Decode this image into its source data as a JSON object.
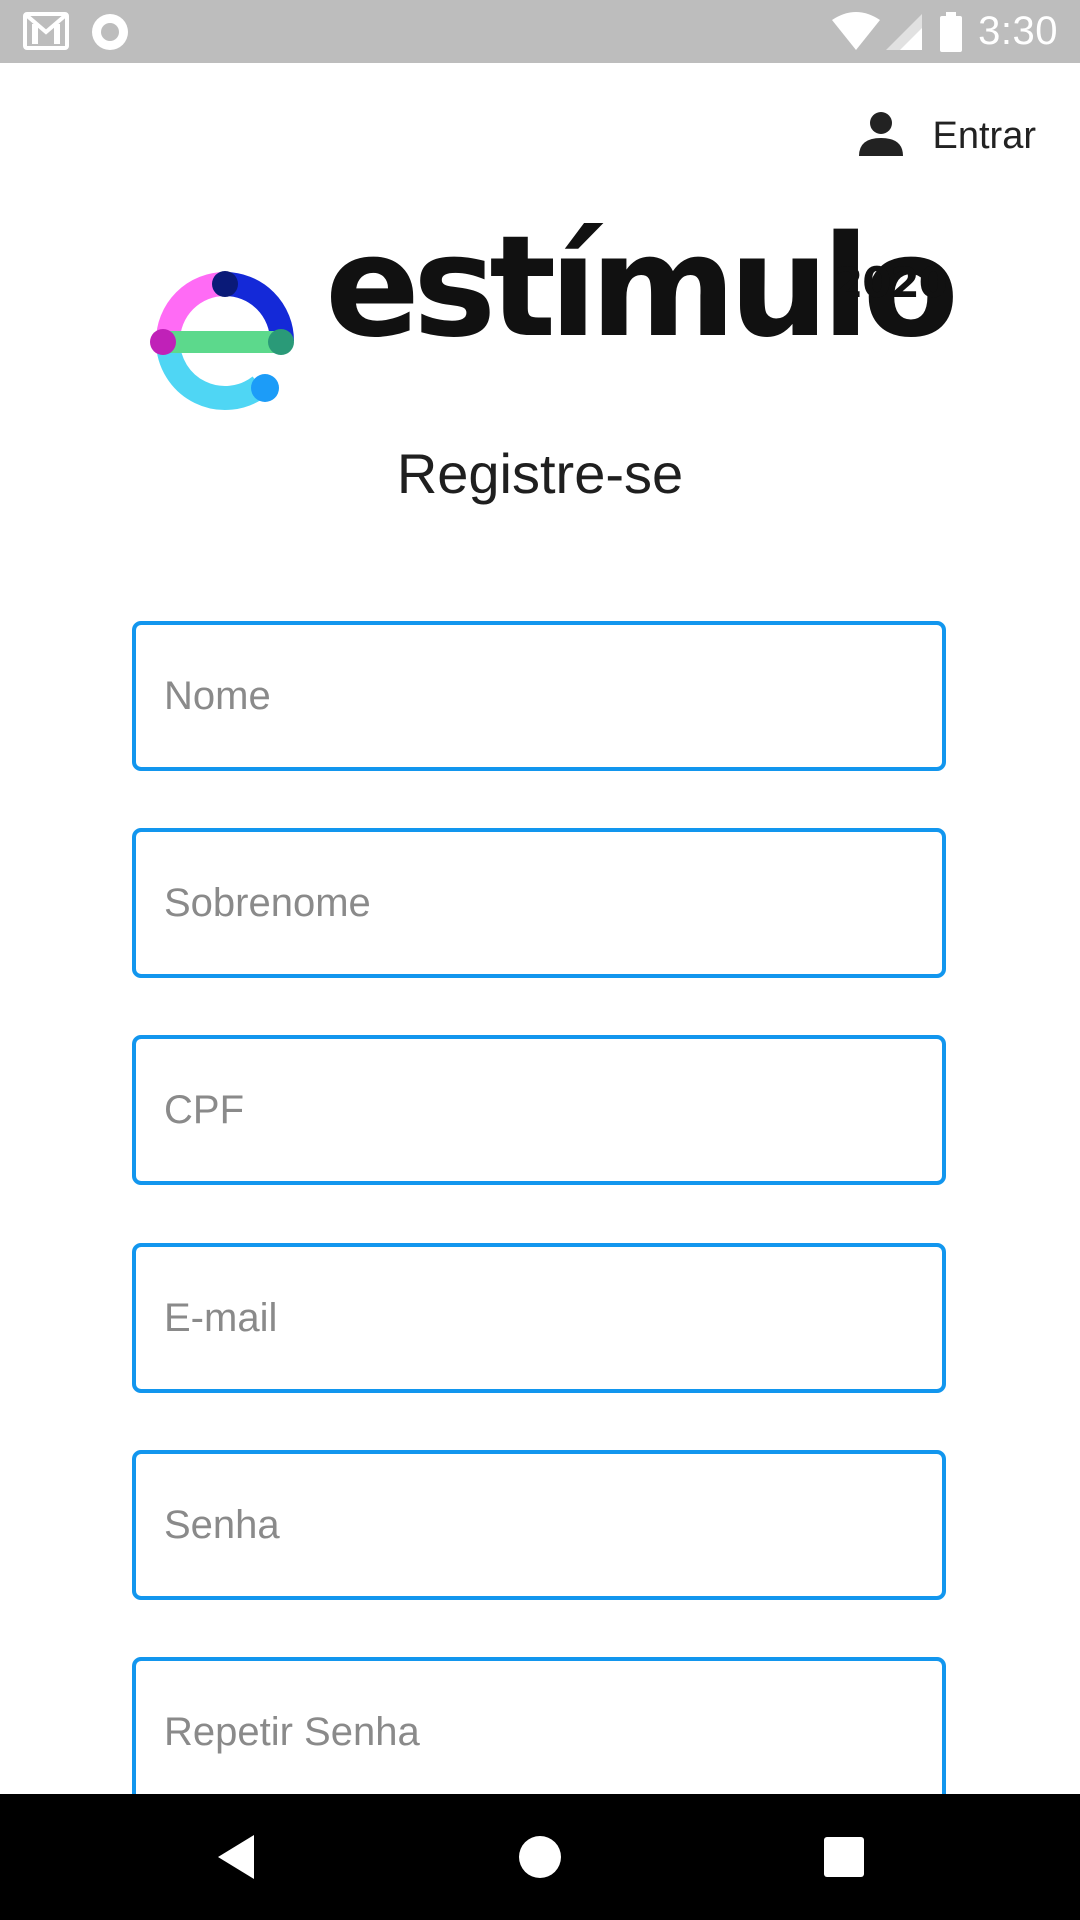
{
  "status_bar": {
    "time": "3:30",
    "icons": [
      "gmail-icon",
      "record-icon",
      "wifi-icon",
      "cell-signal-icon",
      "battery-icon"
    ]
  },
  "header": {
    "login_label": "Entrar",
    "login_icon": "person-icon"
  },
  "logo": {
    "wordmark": "estímulo",
    "year": "2020"
  },
  "page": {
    "title": "Registre-se"
  },
  "form": {
    "fields": [
      {
        "placeholder": "Nome",
        "value": ""
      },
      {
        "placeholder": "Sobrenome",
        "value": ""
      },
      {
        "placeholder": "CPF",
        "value": ""
      },
      {
        "placeholder": "E-mail",
        "value": ""
      },
      {
        "placeholder": "Senha",
        "value": ""
      },
      {
        "placeholder": "Repetir Senha",
        "value": ""
      }
    ]
  },
  "nav_bar": {
    "buttons": [
      "back-icon",
      "home-icon",
      "recents-icon"
    ]
  },
  "colors": {
    "accent": "#1296ee",
    "status_bar": "#bdbdbd",
    "nav_bar": "#000000",
    "text": "#1f1f1f"
  }
}
